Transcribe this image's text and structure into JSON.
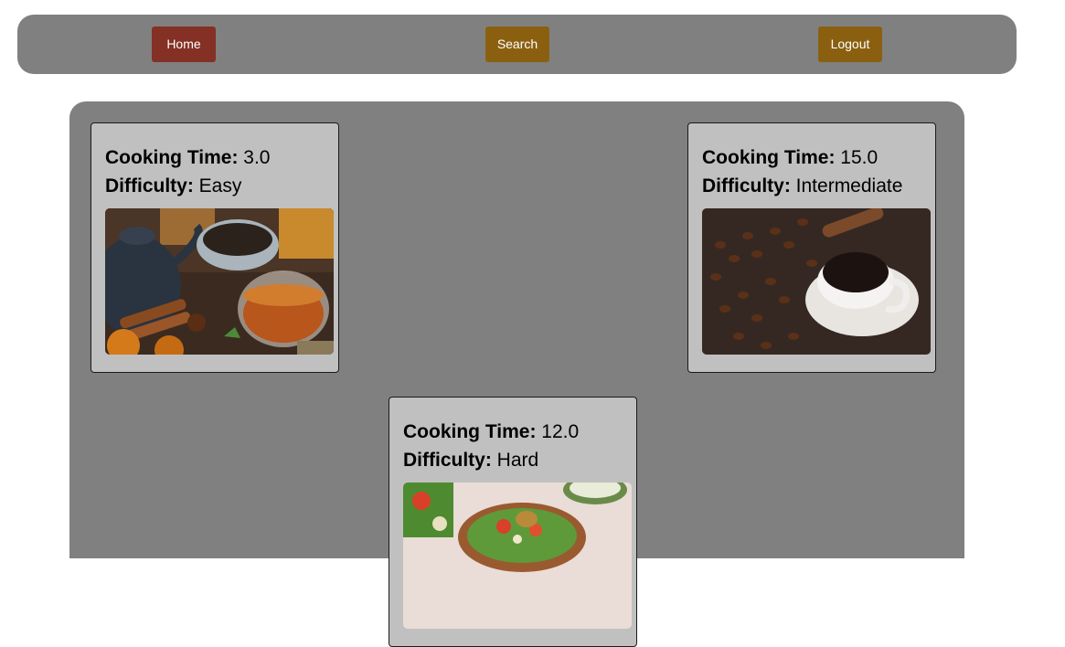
{
  "nav": {
    "home_label": "Home",
    "search_label": "Search",
    "logout_label": "Logout",
    "home_color": "#843024",
    "search_color": "#8a6010",
    "logout_color": "#8a6010"
  },
  "recipes": [
    {
      "cooking_time_label": "Cooking Time:",
      "cooking_time": "3.0",
      "difficulty_label": "Difficulty:",
      "difficulty": "Easy",
      "image": "tea-photo"
    },
    {
      "cooking_time_label": "Cooking Time:",
      "cooking_time": "15.0",
      "difficulty_label": "Difficulty:",
      "difficulty": "Intermediate",
      "image": "coffee-photo"
    },
    {
      "cooking_time_label": "Cooking Time:",
      "cooking_time": "12.0",
      "difficulty_label": "Difficulty:",
      "difficulty": "Hard",
      "image": "salad-photo"
    }
  ]
}
